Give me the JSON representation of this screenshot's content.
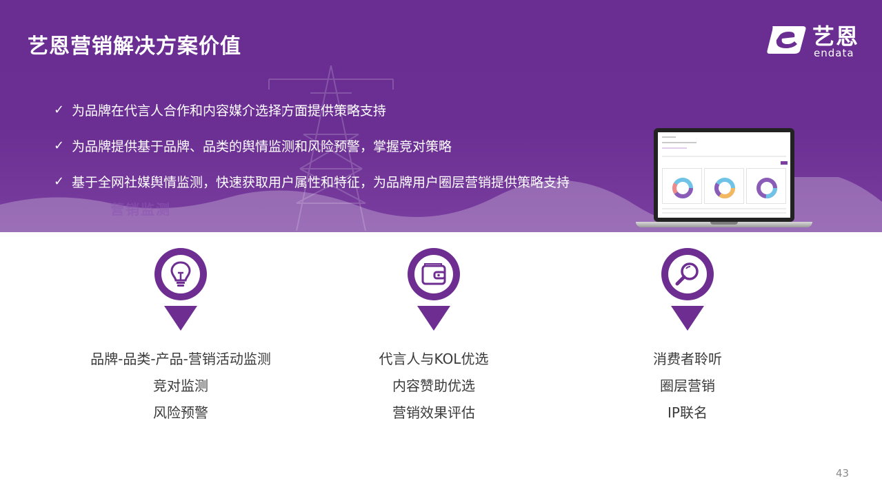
{
  "title": "艺恩营销解决方案价值",
  "logo": {
    "cn": "艺恩",
    "en": "endata"
  },
  "banner_ghost": "营销监测",
  "bullets": [
    "为品牌在代言人合作和内容媒介选择方面提供策略支持",
    "为品牌提供基于品牌、品类的舆情监测和风险预警，掌握竞对策略",
    "基于全网社媒舆情监测，快速获取用户属性和特征，为品牌用户圈层营销提供策略支持"
  ],
  "check_glyph": "✓",
  "features": [
    {
      "icon": "lightbulb-icon",
      "lines": [
        "品牌-品类-产品-营销活动监测",
        "竞对监测",
        "风险预警"
      ]
    },
    {
      "icon": "wallet-icon",
      "lines": [
        "代言人与KOL优选",
        "内容赞助优选",
        "营销效果评估"
      ]
    },
    {
      "icon": "magnifier-icon",
      "lines": [
        "消费者聆听",
        "圈层营销",
        "IP联名"
      ]
    }
  ],
  "page_number": "43",
  "colors": {
    "brand_purple": "#6e2d91",
    "banner": "#6a2d92"
  }
}
